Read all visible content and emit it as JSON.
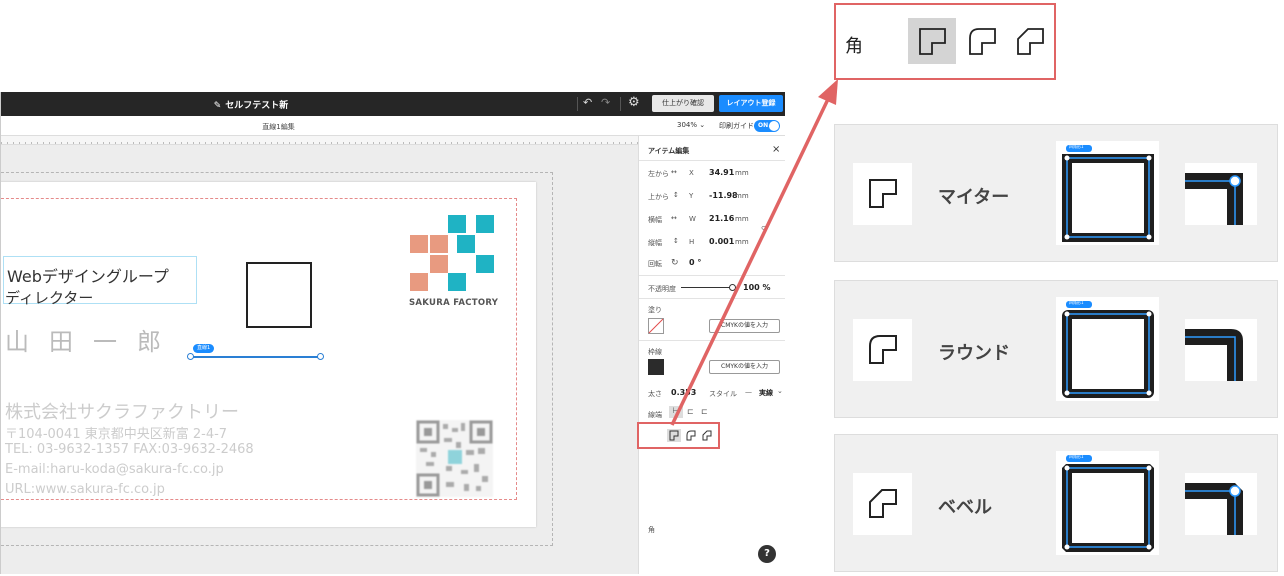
{
  "app": {
    "doc_title": "セルフテスト新",
    "preview_button": "仕上がり確認",
    "register_button": "レイアウト登録",
    "edit_mode": "直線1編集",
    "zoom": "304%",
    "print_guide_label": "印刷ガイド",
    "print_guide_state": "ON"
  },
  "card": {
    "title_line1": "Webデザイングループ",
    "title_line2": "ディレクター",
    "name": "山田一郎",
    "company": "株式会社サクラファクトリー",
    "address": "〒104-0041 東京都中央区新富 2-4-7",
    "tel": "TEL: 03-9632-1357   FAX:03-9632-2468",
    "mail": "E-mail:haru-koda@sakura-fc.co.jp",
    "url": "URL:www.sakura-fc.co.jp",
    "logo_text": "SAKURA FACTORY",
    "line_tag": "直線1",
    "logo_colors": {
      "salmon": "#e89a80",
      "teal": "#1fb3c4"
    }
  },
  "panel": {
    "title": "アイテム編集",
    "close": "×",
    "left_label": "左から",
    "left_axis": "X",
    "left_value": "34.91",
    "top_label": "上から",
    "top_axis": "Y",
    "top_value": "-11.98",
    "width_label": "横幅",
    "width_axis": "W",
    "width_value": "21.16",
    "height_label": "縦幅",
    "height_axis": "H",
    "height_value": "0.001",
    "unit": "mm",
    "rotate_label": "回転",
    "rotate_value": "0 °",
    "opacity_label": "不透明度",
    "opacity_value": "100 %",
    "fill_label": "塗り",
    "cmyk_button": "CMYKの値を入力",
    "stroke_label": "枠線",
    "weight_label": "太さ",
    "weight_value": "0.353",
    "style_label": "スタイル",
    "style_value": "実線",
    "cap_label": "線端",
    "corner_label": "角",
    "help": "?"
  },
  "annotation": {
    "corner_label": "角",
    "rows": [
      {
        "name": "マイター",
        "tag": "四角形1"
      },
      {
        "name": "ラウンド",
        "tag": "四角形1"
      },
      {
        "name": "ベベル",
        "tag": "四角形1"
      }
    ],
    "accent_color": "#e06464",
    "selection_color": "#1a8cff"
  }
}
